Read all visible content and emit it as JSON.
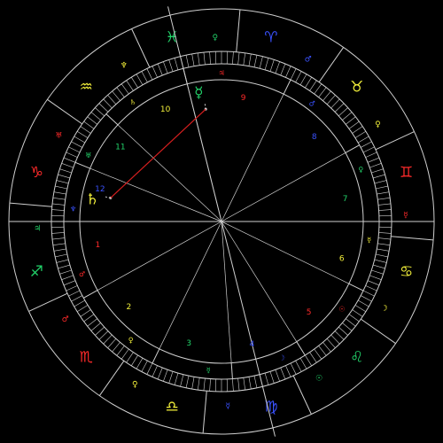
{
  "colors": {
    "background": "#000000",
    "lines": "#cfcfcf",
    "fire": "#ff2a2a",
    "earth": "#f2ef3a",
    "air": "#22d36a",
    "water": "#3a52ff",
    "aspect_red": "#d61f1f"
  },
  "chart_data": {
    "type": "astrological-wheel",
    "signs": [
      {
        "glyph": "♑",
        "ruler": "♅",
        "color": "#ff2a2a"
      },
      {
        "glyph": "♒",
        "ruler": "♆",
        "color": "#f2ef3a"
      },
      {
        "glyph": "♓",
        "ruler": "♀",
        "color": "#22d36a"
      },
      {
        "glyph": "♈",
        "ruler": "♂",
        "color": "#3a52ff"
      },
      {
        "glyph": "♉",
        "ruler": "♀",
        "color": "#f2ef3a"
      },
      {
        "glyph": "♊",
        "ruler": "☿",
        "color": "#ff2a2a"
      },
      {
        "glyph": "♋",
        "ruler": "☽",
        "color": "#f2ef3a"
      },
      {
        "glyph": "♌",
        "ruler": "☉",
        "color": "#22d36a"
      },
      {
        "glyph": "♍",
        "ruler": "☿",
        "color": "#3a52ff"
      },
      {
        "glyph": "♎",
        "ruler": "♀",
        "color": "#f2ef3a"
      },
      {
        "glyph": "♏",
        "ruler": "♂",
        "color": "#ff2a2a"
      },
      {
        "glyph": "♐",
        "ruler": "♃",
        "color": "#22d36a"
      }
    ],
    "houses": [
      {
        "number": "1",
        "ruler": "♂",
        "color": "#ff2a2a"
      },
      {
        "number": "2",
        "ruler": "♀",
        "color": "#f2ef3a"
      },
      {
        "number": "3",
        "ruler": "☿",
        "color": "#22d36a"
      },
      {
        "number": "4",
        "ruler": "☽",
        "color": "#3a52ff"
      },
      {
        "number": "5",
        "ruler": "☉",
        "color": "#ff2a2a"
      },
      {
        "number": "6",
        "ruler": "☿",
        "color": "#f2ef3a"
      },
      {
        "number": "7",
        "ruler": "♀",
        "color": "#22d36a"
      },
      {
        "number": "8",
        "ruler": "♂",
        "color": "#3a52ff"
      },
      {
        "number": "9",
        "ruler": "♃",
        "color": "#ff2a2a"
      },
      {
        "number": "10",
        "ruler": "♄",
        "color": "#f2ef3a"
      },
      {
        "number": "11",
        "ruler": "♅",
        "color": "#22d36a"
      },
      {
        "number": "12",
        "ruler": "♆",
        "color": "#3a52ff"
      }
    ],
    "planets": [
      {
        "name": "saturn",
        "glyph": "♄",
        "color": "#f2ef3a"
      },
      {
        "name": "mercury",
        "glyph": "☿",
        "color": "#22d36a"
      }
    ],
    "aspects": [
      {
        "from": "saturn",
        "to": "mercury",
        "color": "#d61f1f"
      }
    ]
  }
}
